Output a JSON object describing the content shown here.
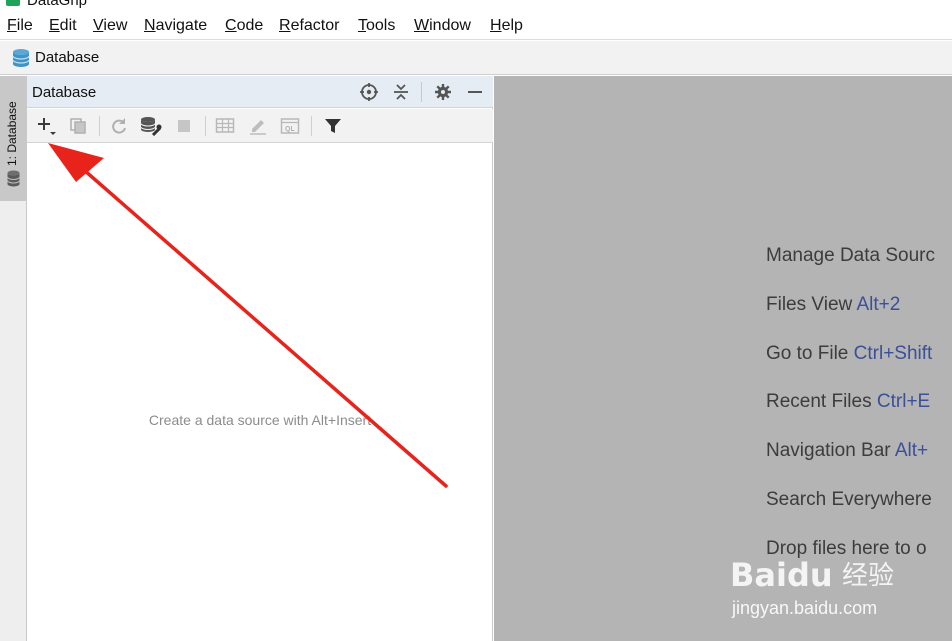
{
  "window": {
    "title": "DataGrip",
    "icon": "datagrip-logo-icon"
  },
  "menu": {
    "items": [
      {
        "first": "F",
        "rest": "ile"
      },
      {
        "first": "E",
        "rest": "dit"
      },
      {
        "first": "V",
        "rest": "iew"
      },
      {
        "first": "N",
        "rest": "avigate"
      },
      {
        "first": "C",
        "rest": "ode"
      },
      {
        "first": "R",
        "rest": "efactor"
      },
      {
        "first": "T",
        "rest": "ools"
      },
      {
        "first": "W",
        "rest": "indow"
      },
      {
        "first": "H",
        "rest": "elp"
      }
    ]
  },
  "navbar": {
    "label": "Database",
    "icon": "database-icon"
  },
  "stripe": {
    "tab_label": "1: Database",
    "tab_icon": "database-icon"
  },
  "panel": {
    "title": "Database",
    "header_buttons": [
      "locate-icon",
      "collapse-all-icon",
      "gear-icon",
      "minimize-icon"
    ],
    "toolbar_buttons": [
      "add-icon",
      "duplicate-icon",
      "refresh-icon",
      "data-source-properties-icon",
      "stop-icon",
      "table-editor-icon",
      "edit-icon",
      "query-console-icon",
      "filter-icon"
    ],
    "empty_text": "Create a data source with Alt+Insert"
  },
  "editor": {
    "hints": [
      {
        "action": "Manage Data Sourc",
        "shortcut": ""
      },
      {
        "action": "Files View",
        "shortcut": "Alt+2"
      },
      {
        "action": "Go to File",
        "shortcut": "Ctrl+Shift"
      },
      {
        "action": "Recent Files",
        "shortcut": "Ctrl+E"
      },
      {
        "action": "Navigation Bar",
        "shortcut": "Alt+"
      },
      {
        "action": "Search Everywhere",
        "shortcut": ""
      },
      {
        "action": "Drop files here to o",
        "shortcut": ""
      }
    ]
  },
  "annotation": {
    "color": "#e8231c"
  },
  "watermark": {
    "brand": "Baidu",
    "cn": "经验",
    "url": "jingyan.baidu.com"
  },
  "colors": {
    "editor_bg": "#b4b4b4",
    "shortcut": "#3c4f9a",
    "panel_header_bg": "#e6ecf3"
  }
}
